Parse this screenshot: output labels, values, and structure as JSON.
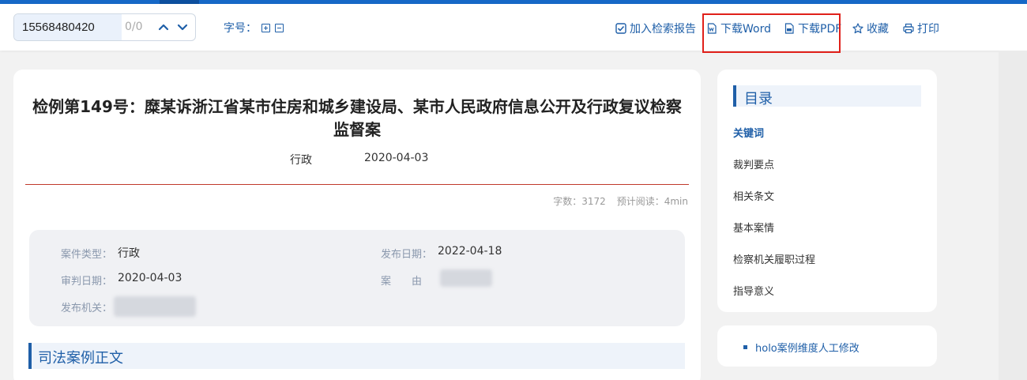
{
  "toolbar": {
    "search_value": "15568480420",
    "search_count": "0/0",
    "font_size_label": "字号：",
    "actions": {
      "add_report": "加入检索报告",
      "download_word": "下载Word",
      "download_pdf": "下载PDF",
      "favorite": "收藏",
      "print": "打印"
    }
  },
  "article": {
    "title": "检例第149号：糜某诉浙江省某市住房和城乡建设局、某市人民政府信息公开及行政复议检察监督案",
    "type": "行政",
    "date": "2020-04-03",
    "stats": {
      "word_count": "字数：3172",
      "read_time": "预计阅读：4min"
    },
    "info": {
      "case_type_label": "案件类型：",
      "case_type_value": "行政",
      "publish_date_label": "发布日期：",
      "publish_date_value": "2022-04-18",
      "trial_date_label": "审判日期：",
      "trial_date_value": "2020-04-03",
      "cause_label": "案　　由",
      "publisher_label": "发布机关："
    },
    "section_title": "司法案例正文"
  },
  "toc": {
    "title": "目录",
    "items": [
      "关键词",
      "裁判要点",
      "相关条文",
      "基本案情",
      "检察机关履职过程",
      "指导意义"
    ]
  },
  "note": {
    "text": "holo案例维度人工修改"
  },
  "colors": {
    "accent": "#1f5fa8",
    "topbar": "#1668c7",
    "highlight_box": "#e0201a",
    "divider": "#c0392b"
  }
}
